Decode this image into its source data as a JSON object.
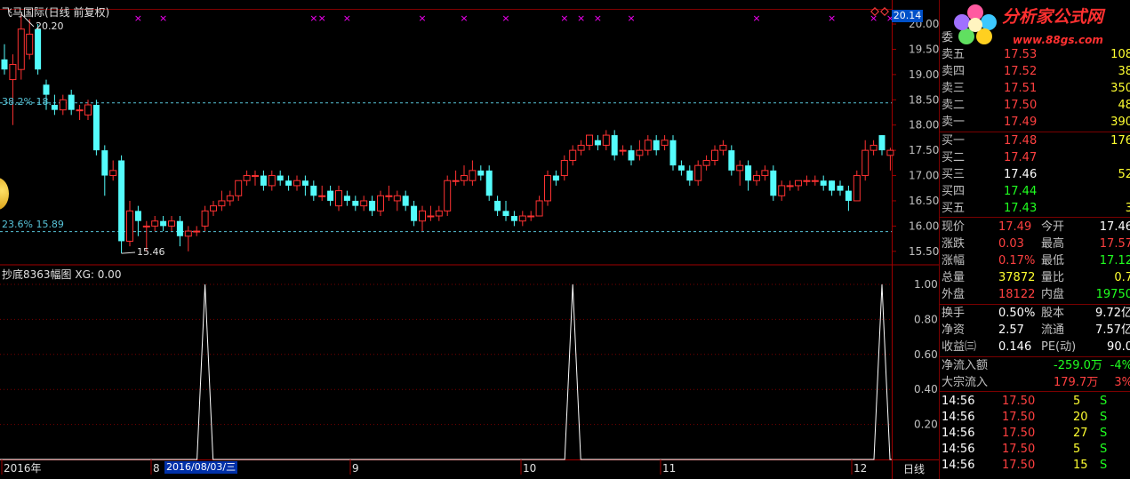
{
  "chart": {
    "title": "飞马国际(日线 前复权)",
    "indicator_title": "抄底8363幅图 XG: 0.00",
    "current_price_box": "20.14",
    "high_label": "20.20",
    "low_label": "15.46",
    "fib_upper": "38.2% 18.",
    "fib_lower": "23.6% 15.89",
    "fib_upper_value": 18.44,
    "fib_lower_value": 15.89,
    "price_axis": [
      "20.00",
      "19.50",
      "19.00",
      "18.50",
      "18.00",
      "17.50",
      "17.00",
      "16.50",
      "16.00",
      "15.50"
    ],
    "indicator_axis": [
      "1.00",
      "0.80",
      "0.60",
      "0.40",
      "0.20"
    ],
    "x_labels": [
      "2016年",
      "8",
      "9",
      "10",
      "11",
      "12"
    ],
    "highlight_date": "2016/08/03/三",
    "period_button": "日线",
    "colors": {
      "up": "#ff3232",
      "down": "#54fcfc",
      "marker": "#ff00ff",
      "grid": "#800000"
    }
  },
  "chart_data": {
    "type": "candlestick",
    "title": "飞马国际(日线 前复权)",
    "y_range": [
      15.25,
      20.3
    ],
    "candles": [
      {
        "o": 19.3,
        "c": 19.1,
        "h": 19.6,
        "l": 19.0
      },
      {
        "o": 18.9,
        "c": 19.2,
        "h": 19.4,
        "l": 18.0
      },
      {
        "o": 19.1,
        "c": 19.9,
        "h": 20.2,
        "l": 18.9
      },
      {
        "o": 19.4,
        "c": 19.8,
        "h": 20.1,
        "l": 19.3
      },
      {
        "o": 19.9,
        "c": 19.1,
        "h": 20.0,
        "l": 19.0
      },
      {
        "o": 18.8,
        "c": 18.6,
        "h": 18.9,
        "l": 18.3
      },
      {
        "o": 18.4,
        "c": 18.3,
        "h": 18.6,
        "l": 18.2
      },
      {
        "o": 18.3,
        "c": 18.5,
        "h": 18.6,
        "l": 18.2
      },
      {
        "o": 18.6,
        "c": 18.3,
        "h": 18.7,
        "l": 18.2
      },
      {
        "o": 18.3,
        "c": 18.3,
        "h": 18.4,
        "l": 18.1
      },
      {
        "o": 18.2,
        "c": 18.4,
        "h": 18.5,
        "l": 18.1
      },
      {
        "o": 18.4,
        "c": 17.5,
        "h": 18.5,
        "l": 17.4
      },
      {
        "o": 17.5,
        "c": 17.0,
        "h": 17.6,
        "l": 16.6
      },
      {
        "o": 17.0,
        "c": 17.1,
        "h": 17.3,
        "l": 16.9
      },
      {
        "o": 17.3,
        "c": 15.7,
        "h": 17.4,
        "l": 15.46
      },
      {
        "o": 15.7,
        "c": 16.3,
        "h": 16.5,
        "l": 15.6
      },
      {
        "o": 16.3,
        "c": 16.1,
        "h": 16.4,
        "l": 15.8
      },
      {
        "o": 16.0,
        "c": 16.0,
        "h": 16.1,
        "l": 15.5
      },
      {
        "o": 16.0,
        "c": 16.1,
        "h": 16.2,
        "l": 15.9
      },
      {
        "o": 16.1,
        "c": 16.0,
        "h": 16.2,
        "l": 15.9
      },
      {
        "o": 16.0,
        "c": 16.1,
        "h": 16.2,
        "l": 15.9
      },
      {
        "o": 16.1,
        "c": 15.8,
        "h": 16.2,
        "l": 15.6
      },
      {
        "o": 15.8,
        "c": 15.9,
        "h": 16.0,
        "l": 15.5
      },
      {
        "o": 15.9,
        "c": 15.9,
        "h": 16.0,
        "l": 15.8
      },
      {
        "o": 16.0,
        "c": 16.3,
        "h": 16.4,
        "l": 15.9
      },
      {
        "o": 16.3,
        "c": 16.4,
        "h": 16.5,
        "l": 16.2
      },
      {
        "o": 16.4,
        "c": 16.5,
        "h": 16.7,
        "l": 16.3
      },
      {
        "o": 16.5,
        "c": 16.6,
        "h": 16.7,
        "l": 16.4
      },
      {
        "o": 16.6,
        "c": 16.9,
        "h": 16.9,
        "l": 16.5
      },
      {
        "o": 16.9,
        "c": 17.0,
        "h": 17.1,
        "l": 16.8
      },
      {
        "o": 17.0,
        "c": 17.0,
        "h": 17.1,
        "l": 16.8
      },
      {
        "o": 17.0,
        "c": 16.8,
        "h": 17.1,
        "l": 16.7
      },
      {
        "o": 16.8,
        "c": 17.0,
        "h": 17.1,
        "l": 16.7
      },
      {
        "o": 17.0,
        "c": 16.9,
        "h": 17.1,
        "l": 16.8
      },
      {
        "o": 16.9,
        "c": 16.8,
        "h": 17.0,
        "l": 16.7
      },
      {
        "o": 16.8,
        "c": 16.9,
        "h": 17.0,
        "l": 16.7
      },
      {
        "o": 16.9,
        "c": 16.8,
        "h": 17.0,
        "l": 16.6
      },
      {
        "o": 16.8,
        "c": 16.6,
        "h": 16.9,
        "l": 16.5
      },
      {
        "o": 16.6,
        "c": 16.6,
        "h": 16.8,
        "l": 16.5
      },
      {
        "o": 16.7,
        "c": 16.5,
        "h": 16.8,
        "l": 16.4
      },
      {
        "o": 16.4,
        "c": 16.7,
        "h": 16.8,
        "l": 16.3
      },
      {
        "o": 16.6,
        "c": 16.5,
        "h": 16.7,
        "l": 16.4
      },
      {
        "o": 16.5,
        "c": 16.4,
        "h": 16.6,
        "l": 16.3
      },
      {
        "o": 16.4,
        "c": 16.5,
        "h": 16.6,
        "l": 16.3
      },
      {
        "o": 16.5,
        "c": 16.3,
        "h": 16.6,
        "l": 16.2
      },
      {
        "o": 16.3,
        "c": 16.6,
        "h": 16.7,
        "l": 16.2
      },
      {
        "o": 16.6,
        "c": 16.6,
        "h": 16.8,
        "l": 16.5
      },
      {
        "o": 16.5,
        "c": 16.6,
        "h": 16.7,
        "l": 16.3
      },
      {
        "o": 16.6,
        "c": 16.4,
        "h": 16.7,
        "l": 16.3
      },
      {
        "o": 16.4,
        "c": 16.1,
        "h": 16.5,
        "l": 16.0
      },
      {
        "o": 16.1,
        "c": 16.3,
        "h": 16.4,
        "l": 15.9
      },
      {
        "o": 16.2,
        "c": 16.2,
        "h": 16.4,
        "l": 16.1
      },
      {
        "o": 16.2,
        "c": 16.3,
        "h": 16.4,
        "l": 16.1
      },
      {
        "o": 16.3,
        "c": 16.9,
        "h": 17.0,
        "l": 16.2
      },
      {
        "o": 16.9,
        "c": 16.9,
        "h": 17.1,
        "l": 16.8
      },
      {
        "o": 16.9,
        "c": 17.0,
        "h": 17.2,
        "l": 16.8
      },
      {
        "o": 16.9,
        "c": 17.1,
        "h": 17.3,
        "l": 16.8
      },
      {
        "o": 17.1,
        "c": 17.0,
        "h": 17.2,
        "l": 16.9
      },
      {
        "o": 17.1,
        "c": 16.6,
        "h": 17.2,
        "l": 16.5
      },
      {
        "o": 16.5,
        "c": 16.3,
        "h": 16.6,
        "l": 16.2
      },
      {
        "o": 16.3,
        "c": 16.2,
        "h": 16.5,
        "l": 16.1
      },
      {
        "o": 16.2,
        "c": 16.1,
        "h": 16.3,
        "l": 16.0
      },
      {
        "o": 16.1,
        "c": 16.2,
        "h": 16.3,
        "l": 16.0
      },
      {
        "o": 16.2,
        "c": 16.2,
        "h": 16.3,
        "l": 16.1
      },
      {
        "o": 16.2,
        "c": 16.5,
        "h": 16.6,
        "l": 16.2
      },
      {
        "o": 16.5,
        "c": 17.0,
        "h": 17.1,
        "l": 16.4
      },
      {
        "o": 17.0,
        "c": 16.9,
        "h": 17.1,
        "l": 16.8
      },
      {
        "o": 17.0,
        "c": 17.3,
        "h": 17.4,
        "l": 16.9
      },
      {
        "o": 17.3,
        "c": 17.5,
        "h": 17.6,
        "l": 17.2
      },
      {
        "o": 17.5,
        "c": 17.6,
        "h": 17.7,
        "l": 17.4
      },
      {
        "o": 17.6,
        "c": 17.8,
        "h": 17.8,
        "l": 17.5
      },
      {
        "o": 17.7,
        "c": 17.6,
        "h": 17.8,
        "l": 17.5
      },
      {
        "o": 17.6,
        "c": 17.8,
        "h": 17.9,
        "l": 17.5
      },
      {
        "o": 17.8,
        "c": 17.4,
        "h": 17.9,
        "l": 17.3
      },
      {
        "o": 17.5,
        "c": 17.5,
        "h": 17.6,
        "l": 17.4
      },
      {
        "o": 17.5,
        "c": 17.3,
        "h": 17.6,
        "l": 17.2
      },
      {
        "o": 17.4,
        "c": 17.5,
        "h": 17.7,
        "l": 17.3
      },
      {
        "o": 17.5,
        "c": 17.7,
        "h": 17.8,
        "l": 17.4
      },
      {
        "o": 17.7,
        "c": 17.5,
        "h": 17.8,
        "l": 17.4
      },
      {
        "o": 17.6,
        "c": 17.7,
        "h": 17.8,
        "l": 17.5
      },
      {
        "o": 17.7,
        "c": 17.2,
        "h": 17.8,
        "l": 17.1
      },
      {
        "o": 17.2,
        "c": 17.1,
        "h": 17.3,
        "l": 17.0
      },
      {
        "o": 17.1,
        "c": 16.9,
        "h": 17.2,
        "l": 16.8
      },
      {
        "o": 16.9,
        "c": 17.2,
        "h": 17.3,
        "l": 16.8
      },
      {
        "o": 17.2,
        "c": 17.3,
        "h": 17.4,
        "l": 17.1
      },
      {
        "o": 17.3,
        "c": 17.5,
        "h": 17.6,
        "l": 17.2
      },
      {
        "o": 17.5,
        "c": 17.6,
        "h": 17.7,
        "l": 17.4
      },
      {
        "o": 17.5,
        "c": 17.1,
        "h": 17.6,
        "l": 17.0
      },
      {
        "o": 17.1,
        "c": 17.2,
        "h": 17.3,
        "l": 16.8
      },
      {
        "o": 17.2,
        "c": 16.9,
        "h": 17.3,
        "l": 16.7
      },
      {
        "o": 16.9,
        "c": 17.0,
        "h": 17.1,
        "l": 16.8
      },
      {
        "o": 17.0,
        "c": 17.1,
        "h": 17.2,
        "l": 16.9
      },
      {
        "o": 17.1,
        "c": 16.6,
        "h": 17.2,
        "l": 16.5
      },
      {
        "o": 16.6,
        "c": 16.8,
        "h": 16.9,
        "l": 16.5
      },
      {
        "o": 16.8,
        "c": 16.8,
        "h": 16.9,
        "l": 16.7
      },
      {
        "o": 16.8,
        "c": 16.9,
        "h": 16.9,
        "l": 16.7
      },
      {
        "o": 16.9,
        "c": 16.9,
        "h": 17.0,
        "l": 16.8
      },
      {
        "o": 16.9,
        "c": 16.9,
        "h": 17.0,
        "l": 16.8
      },
      {
        "o": 16.9,
        "c": 16.8,
        "h": 17.0,
        "l": 16.7
      },
      {
        "o": 16.9,
        "c": 16.7,
        "h": 16.9,
        "l": 16.6
      },
      {
        "o": 16.8,
        "c": 16.7,
        "h": 16.9,
        "l": 16.6
      },
      {
        "o": 16.7,
        "c": 16.5,
        "h": 16.8,
        "l": 16.3
      },
      {
        "o": 16.5,
        "c": 17.0,
        "h": 17.1,
        "l": 16.5
      },
      {
        "o": 17.0,
        "c": 17.5,
        "h": 17.7,
        "l": 16.9
      },
      {
        "o": 17.5,
        "c": 17.6,
        "h": 17.7,
        "l": 17.4
      },
      {
        "o": 17.8,
        "c": 17.5,
        "h": 17.8,
        "l": 17.4
      },
      {
        "o": 17.4,
        "c": 17.5,
        "h": 17.55,
        "l": 17.1
      }
    ],
    "purple_markers": [
      16,
      19,
      37,
      38,
      41,
      50,
      55,
      60,
      67,
      69,
      71,
      75,
      90,
      99,
      104,
      106,
      109
    ],
    "indicator": {
      "name": "抄底8363幅图 XG",
      "value": "0.00",
      "y_range": [
        0,
        1
      ],
      "spikes": [
        24,
        68,
        105
      ]
    }
  },
  "panel": {
    "logo_text": "分析家公式网",
    "logo_url": "www.88gs.com",
    "wei_label": "委",
    "asks": [
      {
        "label": "卖五",
        "price": "17.53",
        "vol": "108"
      },
      {
        "label": "卖四",
        "price": "17.52",
        "vol": "38"
      },
      {
        "label": "卖三",
        "price": "17.51",
        "vol": "350"
      },
      {
        "label": "卖二",
        "price": "17.50",
        "vol": "48"
      },
      {
        "label": "卖一",
        "price": "17.49",
        "vol": "390"
      }
    ],
    "bids": [
      {
        "label": "买一",
        "price": "17.48",
        "vol": "176"
      },
      {
        "label": "买二",
        "price": "17.47",
        "vol": ""
      },
      {
        "label": "买三",
        "price": "17.46",
        "vol": "52"
      },
      {
        "label": "买四",
        "price": "17.44",
        "vol": ""
      },
      {
        "label": "买五",
        "price": "17.43",
        "vol": "3"
      }
    ],
    "stats": [
      {
        "l1": "现价",
        "v1": "17.49",
        "c1": "red",
        "l2": "今开",
        "v2": "17.46",
        "c2": "white"
      },
      {
        "l1": "涨跌",
        "v1": "0.03",
        "c1": "red",
        "l2": "最高",
        "v2": "17.57",
        "c2": "red"
      },
      {
        "l1": "涨幅",
        "v1": "0.17%",
        "c1": "red",
        "l2": "最低",
        "v2": "17.12",
        "c2": "green"
      },
      {
        "l1": "总量",
        "v1": "37872",
        "c1": "yellow",
        "l2": "量比",
        "v2": "0.7",
        "c2": "yellow"
      },
      {
        "l1": "外盘",
        "v1": "18122",
        "c1": "red",
        "l2": "内盘",
        "v2": "19750",
        "c2": "green"
      }
    ],
    "fundamentals": [
      {
        "l1": "换手",
        "v1": "0.50%",
        "l2": "股本",
        "v2": "9.72亿"
      },
      {
        "l1": "净资",
        "v1": "2.57",
        "l2": "流通",
        "v2": "7.57亿"
      },
      {
        "l1": "收益㈢",
        "v1": "0.146",
        "l2": "PE(动)",
        "v2": "90.0"
      }
    ],
    "flows": [
      {
        "label": "净流入额",
        "value": "-259.0万",
        "pct": "-4%",
        "color": "green"
      },
      {
        "label": "大宗流入",
        "value": "179.7万",
        "pct": "3%",
        "color": "red"
      }
    ],
    "ticks": [
      {
        "time": "14:56",
        "price": "17.50",
        "vol": "5",
        "side": "S"
      },
      {
        "time": "14:56",
        "price": "17.50",
        "vol": "20",
        "side": "S"
      },
      {
        "time": "14:56",
        "price": "17.50",
        "vol": "27",
        "side": "S"
      },
      {
        "time": "14:56",
        "price": "17.50",
        "vol": "5",
        "side": "S"
      },
      {
        "time": "14:56",
        "price": "17.50",
        "vol": "15",
        "side": "S"
      }
    ]
  }
}
